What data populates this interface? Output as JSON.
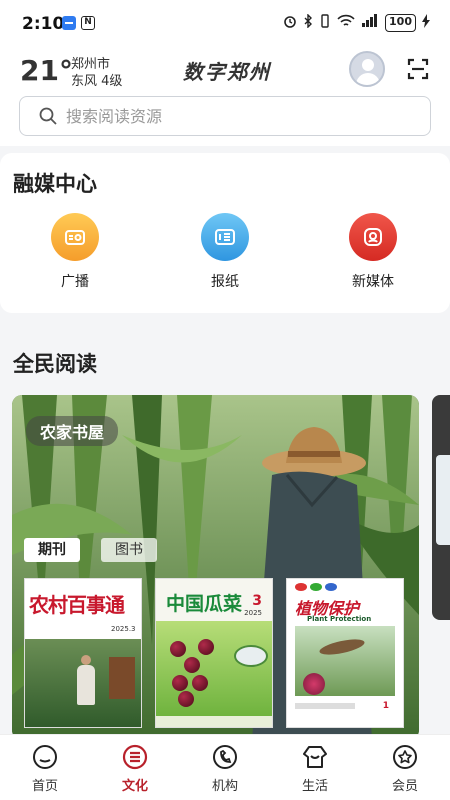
{
  "status_bar": {
    "time": "2:10",
    "nfc_label": "N",
    "battery": "100"
  },
  "header": {
    "temperature": "21°",
    "city": "郑州市",
    "wind": "东风  4级",
    "app_title": "数字郑州"
  },
  "search": {
    "placeholder": "搜索阅读资源"
  },
  "media_center": {
    "title": "融媒中心",
    "items": [
      {
        "label": "广播",
        "icon": "radio-icon",
        "color": "#f5a623"
      },
      {
        "label": "报纸",
        "icon": "newspaper-icon",
        "color": "#3a9de3"
      },
      {
        "label": "新媒体",
        "icon": "new-media-icon",
        "color": "#e0322a"
      }
    ]
  },
  "reading": {
    "title": "全民阅读",
    "banner_tag": "农家书屋",
    "tabs": [
      {
        "label": "期刊",
        "active": true
      },
      {
        "label": "图书",
        "active": false
      }
    ],
    "magazines": [
      {
        "title": "农村百事通",
        "issue": "2025.3"
      },
      {
        "title": "中国瓜菜",
        "issue": "3",
        "year": "2025"
      },
      {
        "title": "植物保护",
        "subtitle": "Plant Protection",
        "issue": "1"
      }
    ]
  },
  "bottom_nav": {
    "items": [
      {
        "label": "首页",
        "icon": "home-icon",
        "active": false
      },
      {
        "label": "文化",
        "icon": "culture-icon",
        "active": true
      },
      {
        "label": "机构",
        "icon": "organization-icon",
        "active": false
      },
      {
        "label": "生活",
        "icon": "life-icon",
        "active": false
      },
      {
        "label": "会员",
        "icon": "member-icon",
        "active": false
      }
    ],
    "active_color": "#b8212b"
  }
}
